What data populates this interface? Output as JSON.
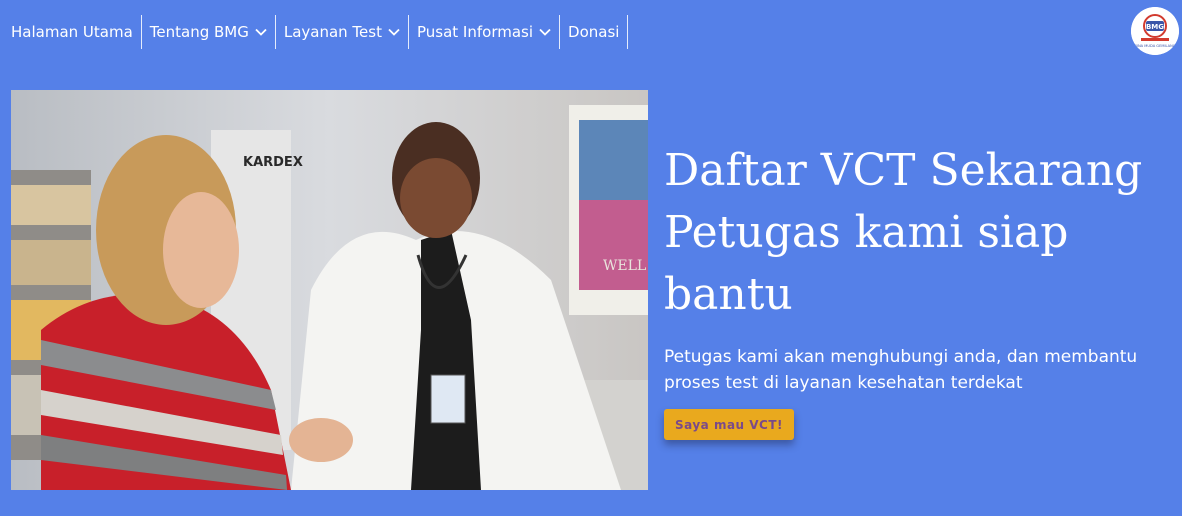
{
  "nav": {
    "items": [
      {
        "label": "Halaman Utama",
        "dropdown": false
      },
      {
        "label": "Tentang BMG",
        "dropdown": true
      },
      {
        "label": "Layanan Test",
        "dropdown": true
      },
      {
        "label": "Pusat Informasi",
        "dropdown": true
      },
      {
        "label": "Donasi",
        "dropdown": false
      }
    ]
  },
  "logo": {
    "text": "BINA MUDA GEMILANG"
  },
  "hero": {
    "title_line1": "Daftar VCT Sekarang",
    "title_line2": "Petugas kami siap",
    "title_line3": "bantu",
    "subtitle_line1": "Petugas kami akan menghubungi anda, dan membantu",
    "subtitle_line2": "proses test di layanan kesehatan terdekat",
    "cta_label": "Saya mau VCT!",
    "image_labels": {
      "sign": "KARDEX",
      "poster": "WELL"
    }
  },
  "colors": {
    "background": "#5580e8",
    "cta": "#e9a91e",
    "cta_text": "#7a4a8a"
  }
}
